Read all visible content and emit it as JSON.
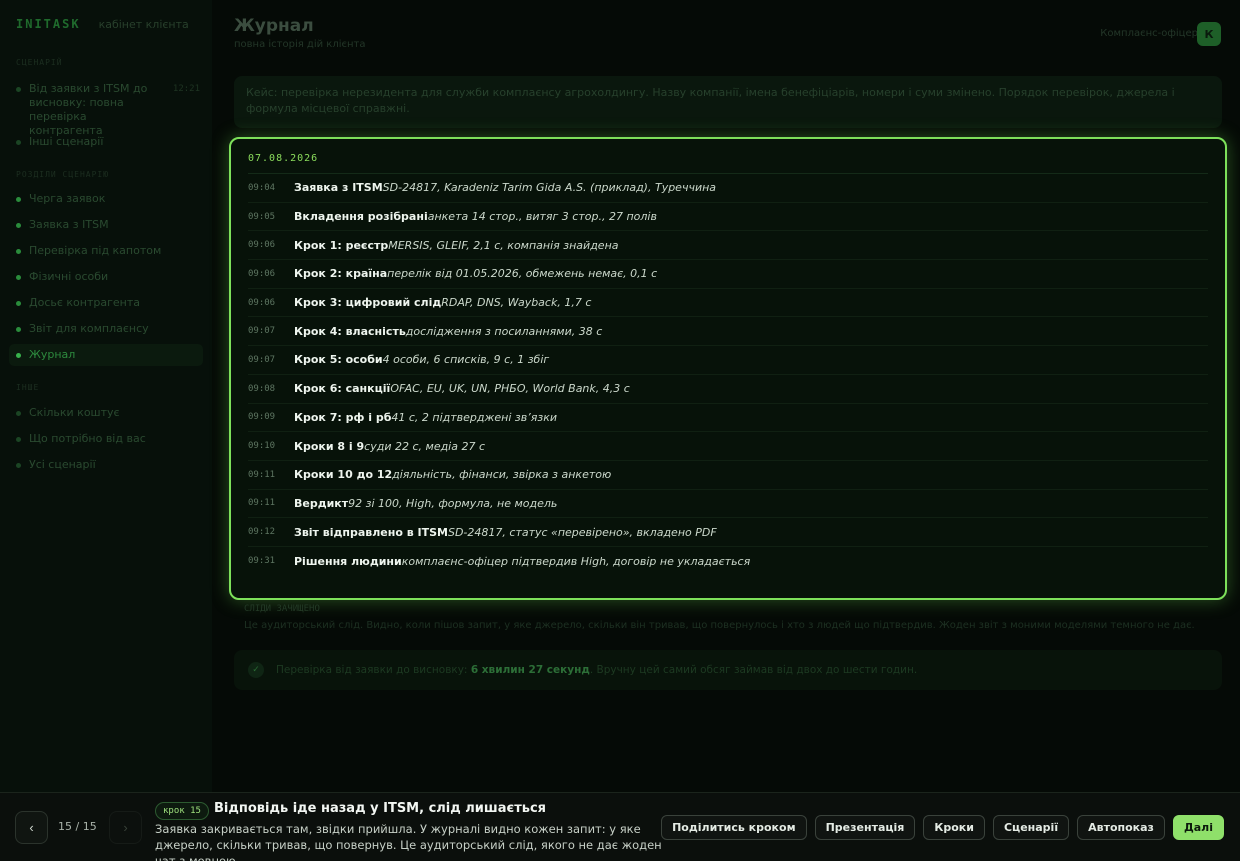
{
  "brand": {
    "logo": "INITASK",
    "subtitle": "кабінет клієнта"
  },
  "sidebar": {
    "sections": [
      {
        "label": "СЦЕНАРІЙ"
      },
      {
        "label": "РОЗДІЛИ СЦЕНАРІЮ"
      },
      {
        "label": "ІНШЕ"
      }
    ],
    "scenario_items": [
      {
        "label": "Від заявки з ITSM до висновку: повна перевірка контрагента",
        "duration": "12:21"
      },
      {
        "label": "Інші сценарії"
      }
    ],
    "chapter_items": [
      {
        "label": "Черга заявок"
      },
      {
        "label": "Заявка з ITSM"
      },
      {
        "label": "Перевірка під капотом"
      },
      {
        "label": "Фізичні особи"
      },
      {
        "label": "Досьє контрагента"
      },
      {
        "label": "Звіт для комплаєнсу"
      },
      {
        "label": "Журнал"
      }
    ],
    "other_items": [
      {
        "label": "Скільки коштує"
      },
      {
        "label": "Що потрібно від вас"
      },
      {
        "label": "Усі сценарії"
      }
    ]
  },
  "header": {
    "title": "Журнал",
    "subtitle": "повна історія дій клієнта",
    "officer_label": "Комплаєнс-офіцер",
    "avatar_letter": "К"
  },
  "case": {
    "text": "Кейс: перевірка нерезидента для служби комплаєнсу агрохолдингу. Назву компанії, імена бенефіціарів, номери і суми змінено. Порядок перевірок, джерела і формула місцевої справжні."
  },
  "journal": {
    "date": "07.08.2026",
    "entries": [
      {
        "time": "09:04",
        "title": "Заявка з ITSM",
        "desc": "SD-24817, Karadeniz Tarim Gida A.S. (приклад), Туреччина"
      },
      {
        "time": "09:05",
        "title": "Вкладення розібрані",
        "desc": "анкета 14 стор., витяг 3 стор., 27 полів"
      },
      {
        "time": "09:06",
        "title": "Крок 1: реєстр",
        "desc": "MERSIS, GLEIF, 2,1 с, компанія знайдена"
      },
      {
        "time": "09:06",
        "title": "Крок 2: країна",
        "desc": "перелік від 01.05.2026, обмежень немає, 0,1 с"
      },
      {
        "time": "09:06",
        "title": "Крок 3: цифровий слід",
        "desc": "RDAP, DNS, Wayback, 1,7 с"
      },
      {
        "time": "09:07",
        "title": "Крок 4: власність",
        "desc": "дослідження з посиланнями, 38 с"
      },
      {
        "time": "09:07",
        "title": "Крок 5: особи",
        "desc": "4 особи, 6 списків, 9 с, 1 збіг"
      },
      {
        "time": "09:08",
        "title": "Крок 6: санкції",
        "desc": "OFAC, EU, UK, UN, РНБО, World Bank, 4,3 с"
      },
      {
        "time": "09:09",
        "title": "Крок 7: рф і рб",
        "desc": "41 с, 2 підтверджені зв’язки"
      },
      {
        "time": "09:10",
        "title": "Кроки 8 і 9",
        "desc": "суди 22 с, медіа 27 с"
      },
      {
        "time": "09:11",
        "title": "Кроки 10 до 12",
        "desc": "діяльність, фінанси, звірка з анкетою"
      },
      {
        "time": "09:11",
        "title": "Вердикт",
        "desc": "92 зі 100, High, формула, не модель"
      },
      {
        "time": "09:12",
        "title": "Звіт відправлено в ITSM",
        "desc": "SD-24817, статус «перевірено», вкладено PDF"
      },
      {
        "time": "09:31",
        "title": "Рішення людини",
        "desc": "комплаєнс-офіцер підтвердив High, договір не укладається"
      }
    ]
  },
  "trace": {
    "title": "СЛІДИ ЗАЧИЩЕНО",
    "text": "Це аудиторський слід. Видно, коли пішов запит, у яке джерело, скільки він тривав, що повернулось і хто з людей що підтвердив. Жоден звіт з моними моделями темного не дає."
  },
  "result": {
    "icon": "✓",
    "prefix": "Перевірка від заявки до висновку:",
    "strong": "6 хвилин 27 секунд",
    "suffix": ". Вручну цей самий обсяг займав від двох до шести годин."
  },
  "bottombar": {
    "prev_icon": "‹",
    "next_icon": "›",
    "current": "15",
    "separator": "/",
    "total": "15",
    "step_pill": "крок 15",
    "step_title": "Відповідь іде назад у ITSM, слід лишається",
    "step_desc": "Заявка закривається там, звідки прийшла. У журналі видно кожен запит: у яке джерело, скільки тривав, що повернув. Це аудиторський слід, якого не дає жоден чат з мовною…",
    "buttons": {
      "share": "Поділитись кроком",
      "presentation": "Презентація",
      "steps": "Кроки",
      "scenarios": "Сценарії",
      "autoplay": "Автопоказ",
      "next": "Далі"
    }
  }
}
